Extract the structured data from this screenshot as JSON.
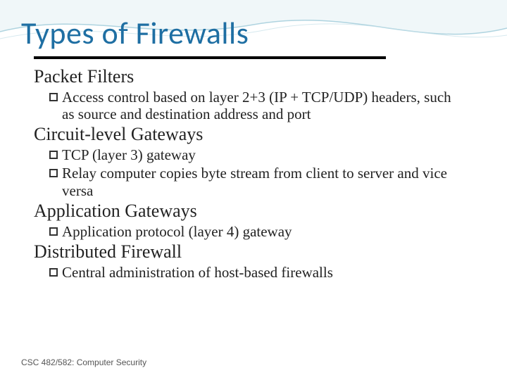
{
  "title": "Types of Firewalls",
  "sections": [
    {
      "heading": "Packet Filters",
      "bullets": [
        "Access control based on layer 2+3  (IP + TCP/UDP) headers, such as source and destination address and port"
      ]
    },
    {
      "heading": "Circuit-level Gateways",
      "bullets": [
        "TCP (layer 3) gateway",
        "Relay computer copies byte stream from client to server and vice versa"
      ]
    },
    {
      "heading": "Application Gateways",
      "bullets": [
        "Application protocol (layer 4) gateway"
      ]
    },
    {
      "heading": "Distributed Firewall",
      "bullets": [
        "Central administration of host-based firewalls"
      ]
    }
  ],
  "footer": "CSC 482/582: Computer Security"
}
